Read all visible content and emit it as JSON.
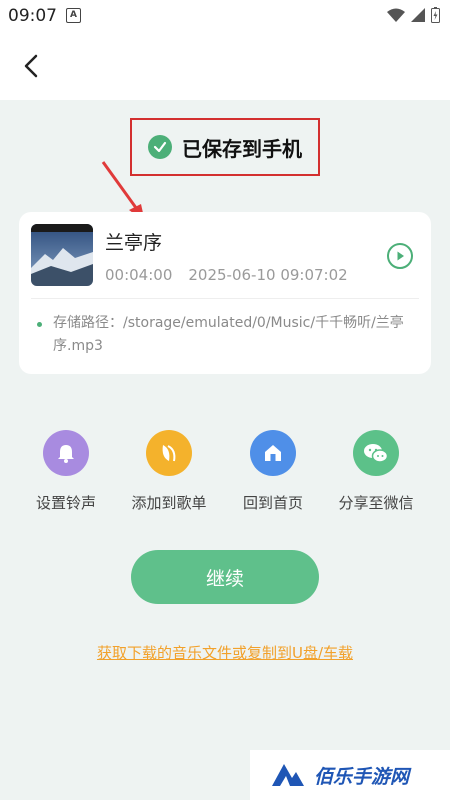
{
  "status_bar": {
    "time": "09:07",
    "notification_letter": "A"
  },
  "saved_banner": {
    "text": "已保存到手机"
  },
  "song": {
    "title": "兰亭序",
    "duration": "00:04:00",
    "datetime": "2025-06-10 09:07:02",
    "path_label": "存储路径：",
    "path_value": "/storage/emulated/0/Music/千千畅听/兰亭序.mp3"
  },
  "actions": [
    {
      "label": "设置铃声",
      "icon": "bell-icon",
      "color": "#a88be0"
    },
    {
      "label": "添加到歌单",
      "icon": "playlist-icon",
      "color": "#f4b22c"
    },
    {
      "label": "回到首页",
      "icon": "home-icon",
      "color": "#4f8fe8"
    },
    {
      "label": "分享至微信",
      "icon": "wechat-icon",
      "color": "#5cc189"
    }
  ],
  "continue_label": "继续",
  "footer_link": "获取下载的音乐文件或复制到U盘/车载",
  "watermark": {
    "text": "佰乐手游网"
  },
  "colors": {
    "accent_green": "#5fc08b",
    "highlight_red": "#d32f2f",
    "link_orange": "#f2a12b"
  }
}
